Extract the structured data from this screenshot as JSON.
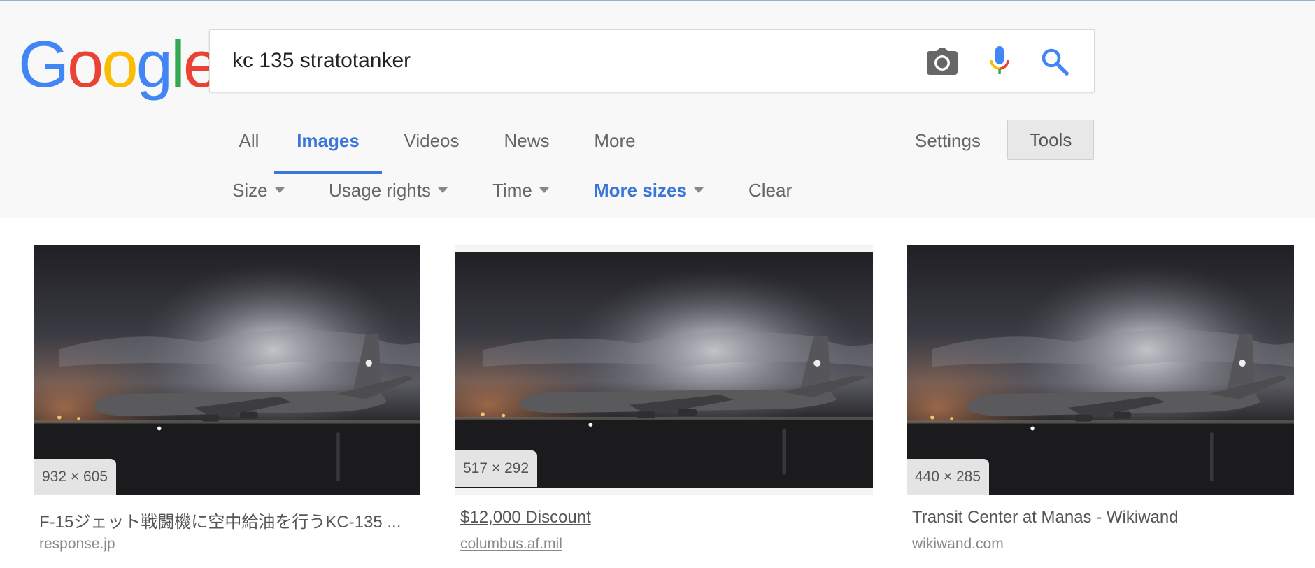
{
  "search": {
    "query": "kc 135 stratotanker"
  },
  "logo": {
    "letters": [
      "G",
      "o",
      "o",
      "g",
      "l",
      "e"
    ],
    "colors": [
      "#4285f4",
      "#ea4335",
      "#fbbc05",
      "#4285f4",
      "#34a853",
      "#ea4335"
    ]
  },
  "tabs": [
    {
      "label": "All",
      "active": false
    },
    {
      "label": "Images",
      "active": true
    },
    {
      "label": "Videos",
      "active": false
    },
    {
      "label": "News",
      "active": false
    },
    {
      "label": "More",
      "active": false
    }
  ],
  "settings_label": "Settings",
  "tools_label": "Tools",
  "tools": [
    {
      "label": "Size",
      "dropdown": true,
      "active": false
    },
    {
      "label": "Usage rights",
      "dropdown": true,
      "active": false
    },
    {
      "label": "Time",
      "dropdown": true,
      "active": false
    },
    {
      "label": "More sizes",
      "dropdown": true,
      "active": true
    },
    {
      "label": "Clear",
      "dropdown": false,
      "active": false
    }
  ],
  "results": [
    {
      "dimensions": "932 × 605",
      "title": "F-15ジェット戦闘機に空中給油を行うKC-135 ...",
      "source": "response.jp"
    },
    {
      "dimensions": "517 × 292",
      "title": "$12,000 Discount",
      "source": "columbus.af.mil"
    },
    {
      "dimensions": "440 × 285",
      "title": "Transit Center at Manas - Wikiwand",
      "source": "wikiwand.com"
    }
  ],
  "colors": {
    "accent": "#3a76d8",
    "camera_icon": "#666666",
    "search_icon": "#4285f4"
  }
}
